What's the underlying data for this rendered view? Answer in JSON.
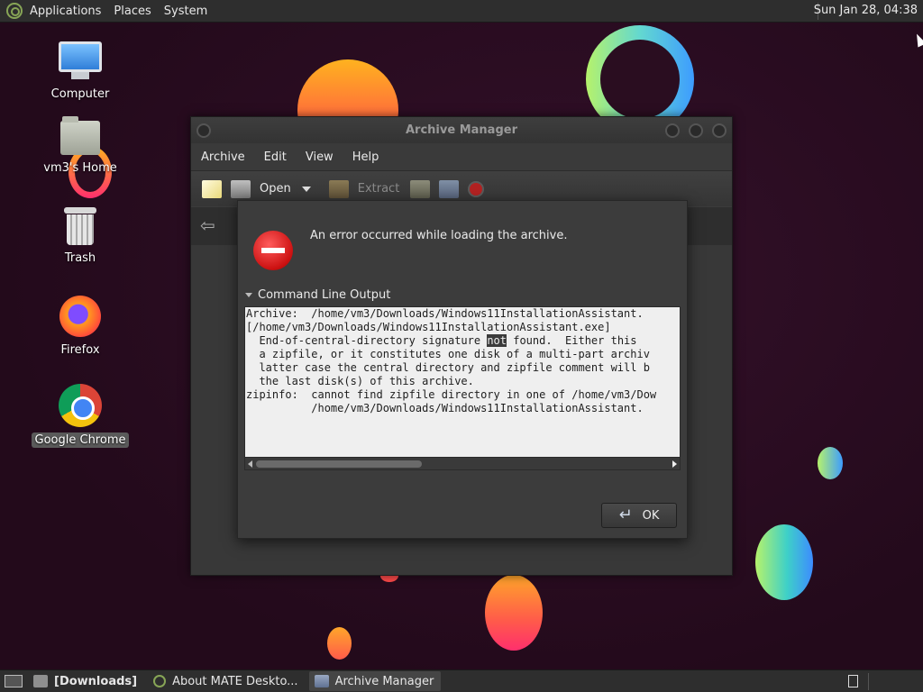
{
  "top_panel": {
    "menus": [
      "Applications",
      "Places",
      "System"
    ],
    "clock": "Sun Jan 28, 04:38"
  },
  "desktop": {
    "icons": [
      {
        "label": "Computer",
        "icon": "computer-icon"
      },
      {
        "label": "vm3's Home",
        "icon": "home-folder-icon"
      },
      {
        "label": "Trash",
        "icon": "trash-icon"
      },
      {
        "label": "Firefox",
        "icon": "firefox-icon"
      },
      {
        "label": "Google Chrome",
        "icon": "chrome-icon"
      }
    ]
  },
  "archive_manager": {
    "title": "Archive Manager",
    "menus": [
      "Archive",
      "Edit",
      "View",
      "Help"
    ],
    "toolbar": {
      "open_label": "Open",
      "extract_label": "Extract"
    }
  },
  "error_dialog": {
    "message": "An error occurred while loading the archive.",
    "expander_label": "Command Line Output",
    "output_lines": [
      "Archive:  /home/vm3/Downloads/Windows11InstallationAssistant.",
      "[/home/vm3/Downloads/Windows11InstallationAssistant.exe]",
      "  End-of-central-directory signature ",
      "  a zipfile, or it constitutes one disk of a multi-part archiv",
      "  latter case the central directory and zipfile comment will b",
      "  the last disk(s) of this archive.",
      "zipinfo:  cannot find zipfile directory in one of /home/vm3/Dow",
      "          /home/vm3/Downloads/Windows11InstallationAssistant."
    ],
    "highlighted_word": "not",
    "line3_suffix": " found.  Either this",
    "ok_label": "OK"
  },
  "bottom_panel": {
    "tasks": [
      {
        "label": "[Downloads]",
        "icon": "folder-icon"
      },
      {
        "label": "About MATE Deskto...",
        "icon": "mate-icon"
      },
      {
        "label": "Archive Manager",
        "icon": "archive-manager-icon"
      }
    ]
  },
  "colors": {
    "wallpaper": "#2a0d20",
    "panel": "#2e2e2e",
    "dialog": "#3c3c3c",
    "output_bg": "#efefef",
    "error_red": "#cc1111"
  }
}
